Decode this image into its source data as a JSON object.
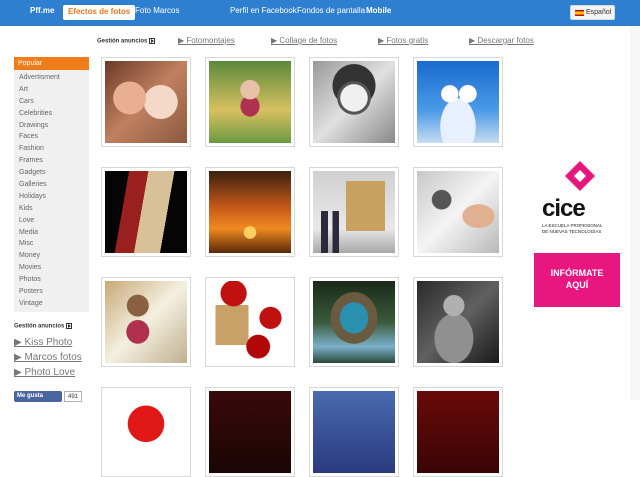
{
  "topbar": {
    "logo": "Pff.me",
    "items": [
      "Efectos de fotos",
      "Foto Marcos",
      "Perfil en Facebook",
      "Fondos de pantalla",
      "Mobile"
    ],
    "language": "Español"
  },
  "ads_row": {
    "label": "Gestión anuncios",
    "links": [
      "▶ Fotomontajes",
      "▶ Collage de fotos",
      "▶ Fotos gratis",
      "▶ Descargar fotos"
    ]
  },
  "sidebar": {
    "active": "Popular",
    "categories": [
      "Advertisment",
      "Art",
      "Cars",
      "Celebrities",
      "Drawings",
      "Faces",
      "Fashion",
      "Frames",
      "Gadgets",
      "Galleries",
      "Holidays",
      "Kids",
      "Love",
      "Media",
      "Misc",
      "Money",
      "Movies",
      "Photos",
      "Posters",
      "Vintage"
    ],
    "ads_label": "Gestión anuncios",
    "ad_links": [
      "▶ Kiss Photo",
      "▶ Marcos fotos",
      "▶ Photo Love"
    ],
    "like_label": "Me gusta",
    "like_count": "491"
  },
  "banner": {
    "brand": "cice",
    "sub1": "LA ESCUELA PROFESIONAL",
    "sub2": "DE NUEVAS TECNOLOGÍAS",
    "cta_line1": "INFÓRMATE",
    "cta_line2": "AQUÍ",
    "brand_color": "#e7177f"
  },
  "thumbnails": [
    {
      "icon": "kiss-photo"
    },
    {
      "icon": "girl-on-grass-photo"
    },
    {
      "icon": "pencil-sketch-photo"
    },
    {
      "icon": "heart-clouds-photo"
    },
    {
      "icon": "phone-photo"
    },
    {
      "icon": "sunset-palm-photo"
    },
    {
      "icon": "gallery-visitors-photo"
    },
    {
      "icon": "drawing-hand-photo"
    },
    {
      "icon": "sketch-notebook-photo"
    },
    {
      "icon": "roses-frame-photo"
    },
    {
      "icon": "cave-waterfall-photo"
    },
    {
      "icon": "bodybuilder-photo"
    },
    {
      "icon": "red-heart-photo"
    },
    {
      "icon": "dark-photo"
    },
    {
      "icon": "blue-photo"
    },
    {
      "icon": "red-photo"
    }
  ]
}
